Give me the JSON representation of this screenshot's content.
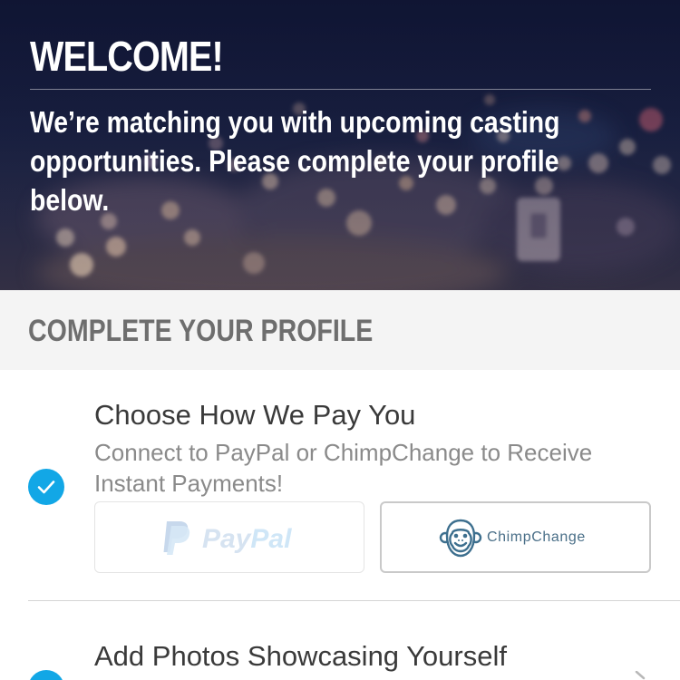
{
  "hero": {
    "title": "WELCOME!",
    "subtitle": "We’re matching you with upcoming casting opportunities. Please complete your profile below."
  },
  "section": {
    "title": "COMPLETE YOUR PROFILE"
  },
  "steps": [
    {
      "title": "Choose How We Pay You",
      "description": "Connect to PayPal or ChimpChange to Receive Instant Payments!",
      "completed": true,
      "options": [
        {
          "label_part1": "Pay",
          "label_part2": "Pal",
          "icon": "paypal-logo-icon",
          "state": "faded"
        },
        {
          "label": "ChimpChange",
          "icon": "chimp-monkey-icon",
          "state": "selected"
        }
      ]
    },
    {
      "title": "Add Photos Showcasing Yourself",
      "completed": true,
      "icon": "chevron-right-icon"
    }
  ],
  "colors": {
    "accent": "#12a7e6",
    "section_bg": "#f4f4f4",
    "section_text": "#6e6e6e",
    "title_text": "#3a3a3a",
    "desc_text": "#8a8a8a",
    "chimp_text": "#4a6f88"
  }
}
